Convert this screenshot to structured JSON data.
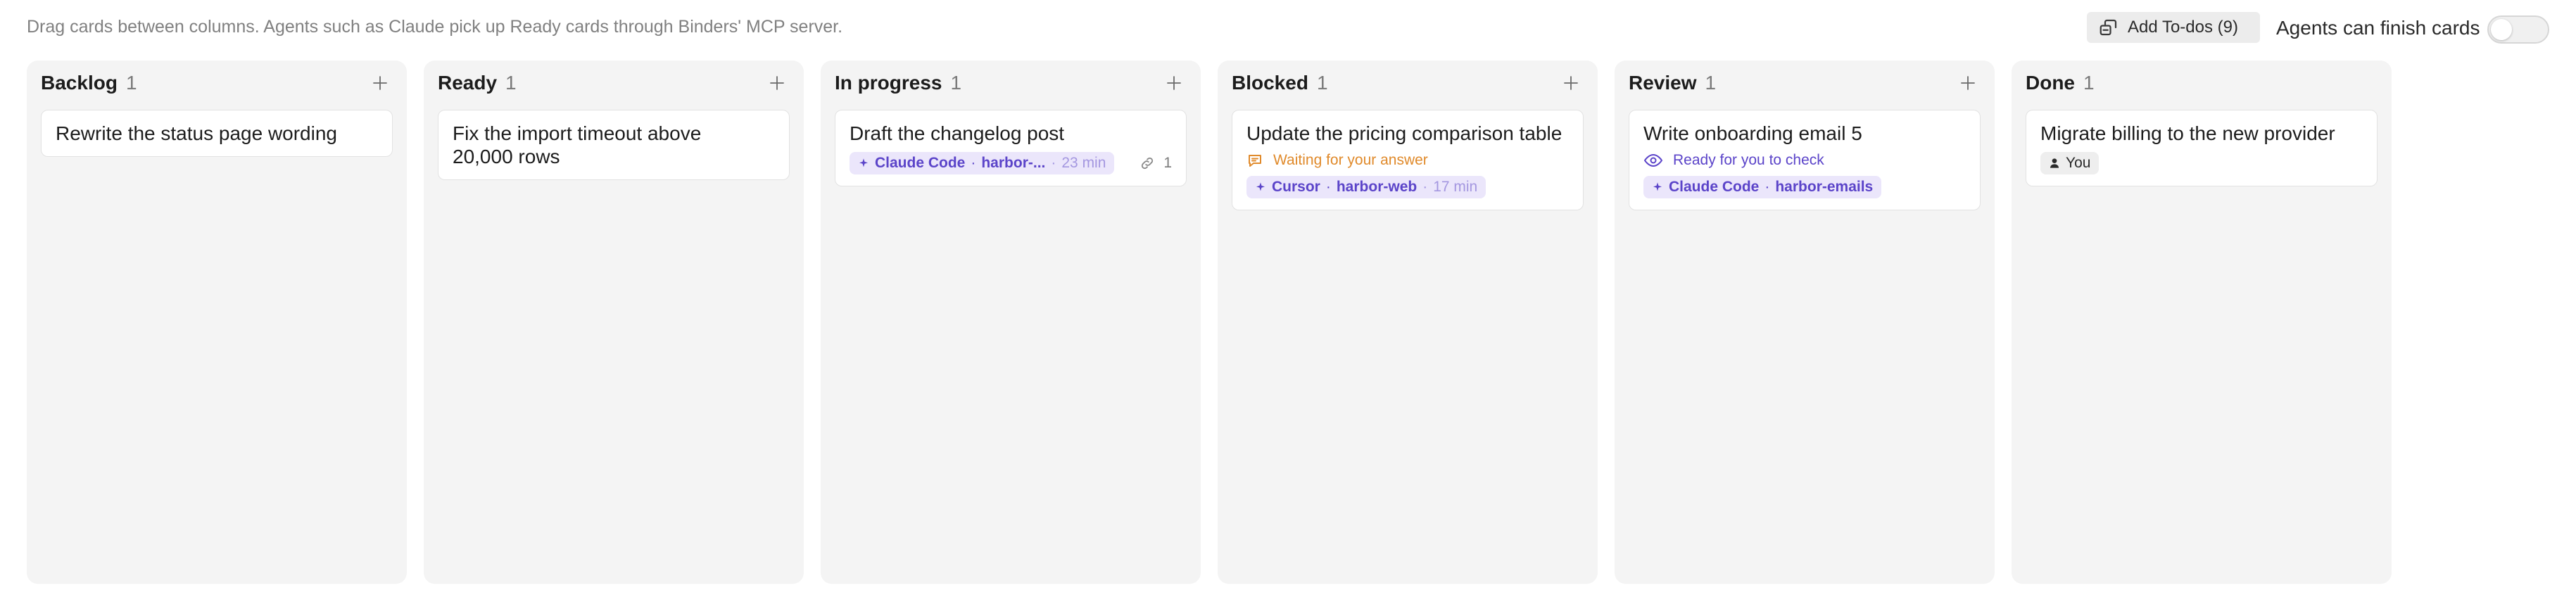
{
  "header": {
    "hint": "Drag cards between columns. Agents such as Claude pick up Ready cards through Binders' MCP server.",
    "add_todos_label": "Add To-dos (9)",
    "agents_toggle_label": "Agents can finish cards",
    "agents_toggle_on": false
  },
  "columns": [
    {
      "title": "Backlog",
      "count": "1",
      "cards": [
        {
          "title": "Rewrite the status page wording"
        }
      ]
    },
    {
      "title": "Ready",
      "count": "1",
      "cards": [
        {
          "title": "Fix the import timeout above 20,000 rows"
        }
      ]
    },
    {
      "title": "In progress",
      "count": "1",
      "cards": [
        {
          "title": "Draft the changelog post",
          "agent": {
            "name": "Claude Code",
            "repo": "harbor-...",
            "minutes": "23 min"
          },
          "links_count": "1"
        }
      ]
    },
    {
      "title": "Blocked",
      "count": "1",
      "cards": [
        {
          "title": "Update the pricing comparison table",
          "status": "Waiting for your answer",
          "agent": {
            "name": "Cursor",
            "repo": "harbor-web",
            "minutes": "17 min"
          }
        }
      ]
    },
    {
      "title": "Review",
      "count": "1",
      "cards": [
        {
          "title": "Write onboarding email 5",
          "status": "Ready for you to check",
          "agent": {
            "name": "Claude Code",
            "repo": "harbor-emails"
          }
        }
      ]
    },
    {
      "title": "Done",
      "count": "1",
      "cards": [
        {
          "title": "Migrate billing to the new provider",
          "assignee": "You"
        }
      ]
    }
  ],
  "colors": {
    "agent_chip_bg": "#ebe6fb",
    "agent_chip_text": "#5b44c9",
    "waiting_status": "#e08a2b",
    "review_status": "#5b44c9",
    "column_bg": "#f4f4f4"
  },
  "icons": {
    "add_todos": "import-icon",
    "column_add": "plus-icon",
    "agent": "sparkle-icon",
    "waiting": "speech-bubble-icon",
    "review": "eye-icon",
    "links": "link-icon",
    "assignee": "person-icon"
  },
  "separator": "·"
}
